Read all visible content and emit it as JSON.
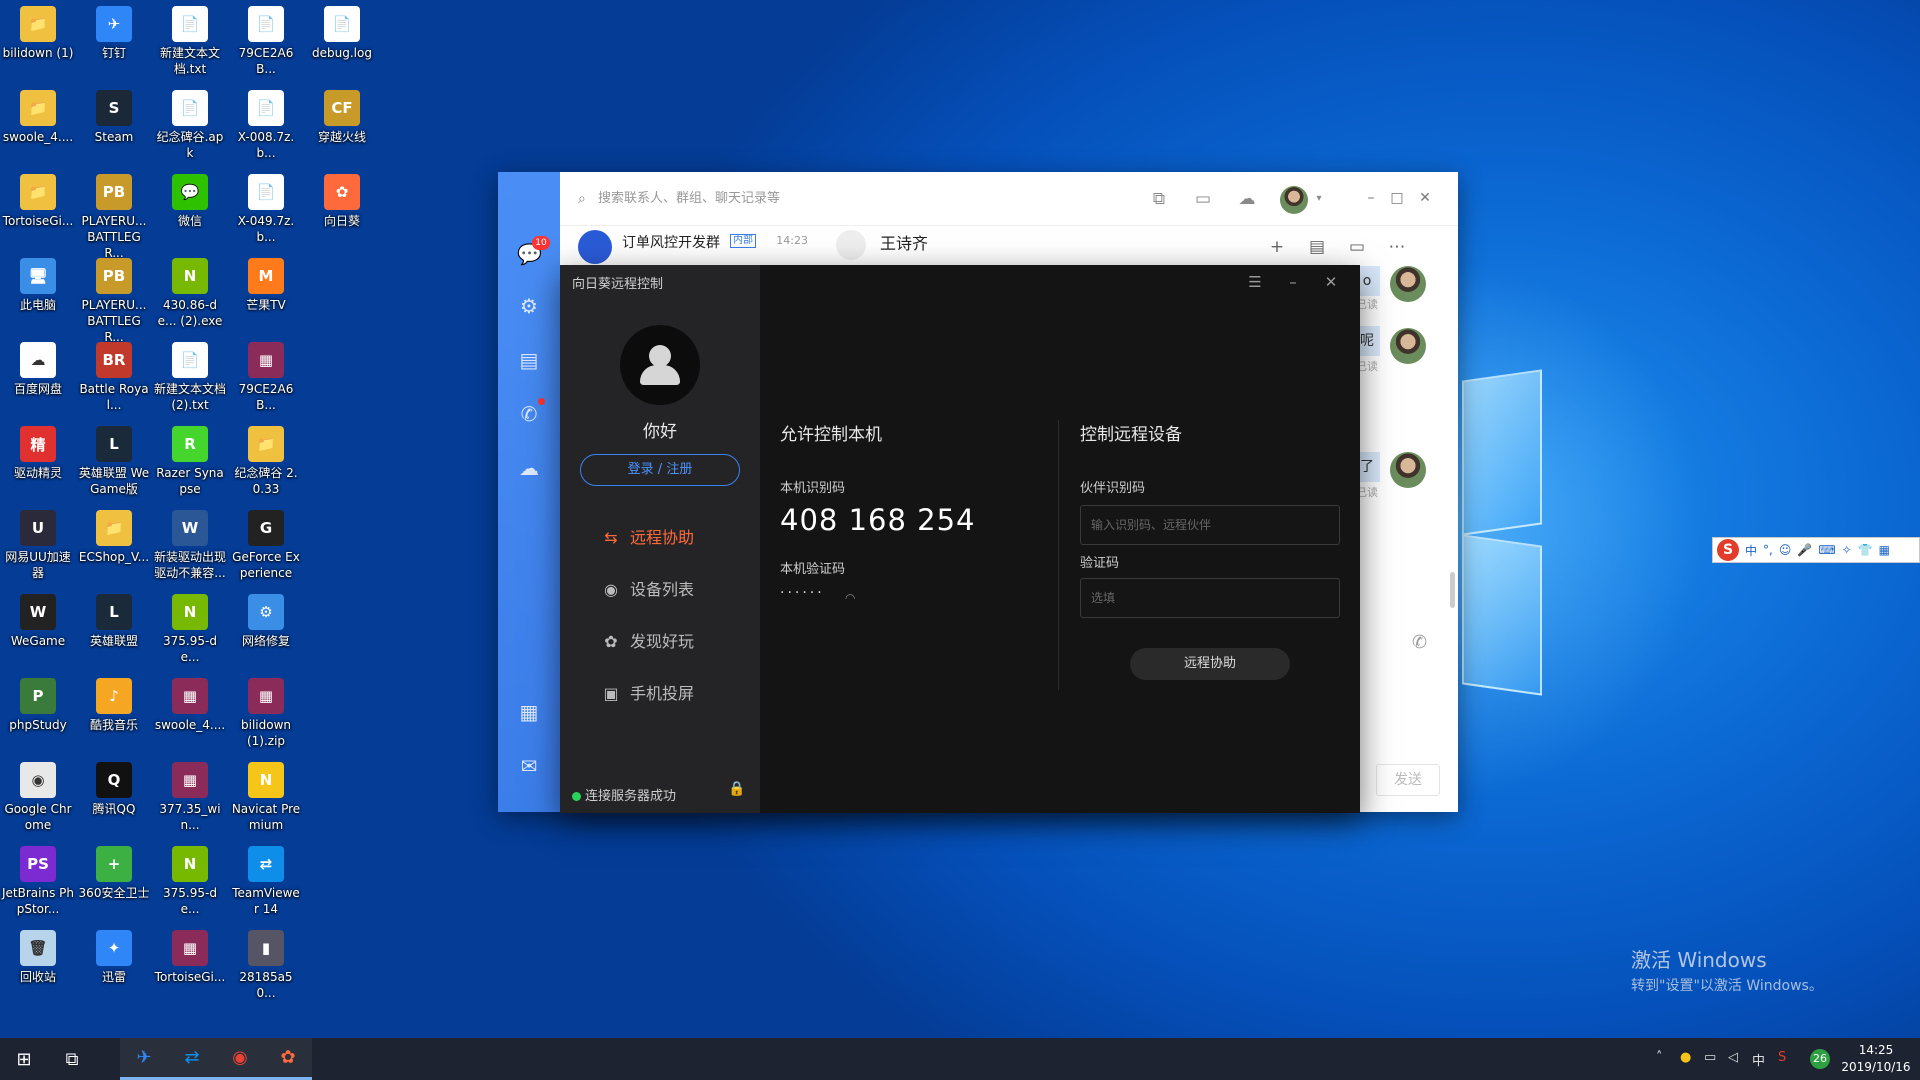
{
  "desktop": {
    "icons": [
      {
        "label": "bilidown (1)",
        "glyph": "📁",
        "color": "#f0c040"
      },
      {
        "label": "swoole_4....",
        "glyph": "📁",
        "color": "#f0c040"
      },
      {
        "label": "TortoiseGi...",
        "glyph": "📁",
        "color": "#f0c040"
      },
      {
        "label": "此电脑",
        "glyph": "🖥",
        "color": "#3a8ee6"
      },
      {
        "label": "百度网盘",
        "glyph": "☁",
        "color": "#ffffff"
      },
      {
        "label": "驱动精灵",
        "glyph": "精",
        "color": "#e03030"
      },
      {
        "label": "网易UU加速器",
        "glyph": "U",
        "color": "#2a2a3a"
      },
      {
        "label": "WeGame",
        "glyph": "W",
        "color": "#222222"
      },
      {
        "label": "phpStudy",
        "glyph": "P",
        "color": "#3a7a3a"
      },
      {
        "label": "Google Chrome",
        "glyph": "◉",
        "color": "#e8e8e8"
      },
      {
        "label": "JetBrains PhpStor...",
        "glyph": "PS",
        "color": "#7b2bd1"
      },
      {
        "label": "回收站",
        "glyph": "🗑",
        "color": "#b8d4ea"
      },
      {
        "label": "钉钉",
        "glyph": "✈",
        "color": "#2f86f6"
      },
      {
        "label": "Steam",
        "glyph": "S",
        "color": "#1b2838"
      },
      {
        "label": "PLAYERU... BATTLEGR...",
        "glyph": "PB",
        "color": "#c79a2a"
      },
      {
        "label": "PLAYERU... BATTLEGR...",
        "glyph": "PB",
        "color": "#c79a2a"
      },
      {
        "label": "Battle Royal...",
        "glyph": "BR",
        "color": "#c0392b"
      },
      {
        "label": "英雄联盟 WeGame版",
        "glyph": "L",
        "color": "#1a2a3a"
      },
      {
        "label": "ECShop_V...",
        "glyph": "📁",
        "color": "#f0c040"
      },
      {
        "label": "英雄联盟",
        "glyph": "L",
        "color": "#1a2a3a"
      },
      {
        "label": "酷我音乐",
        "glyph": "♪",
        "color": "#f5a623"
      },
      {
        "label": "腾讯QQ",
        "glyph": "Q",
        "color": "#111111"
      },
      {
        "label": "360安全卫士",
        "glyph": "+",
        "color": "#3cb043"
      },
      {
        "label": "迅雷",
        "glyph": "✦",
        "color": "#2f86f6"
      },
      {
        "label": "新建文本文档.txt",
        "glyph": "📄",
        "color": "#ffffff"
      },
      {
        "label": "纪念碑谷.apk",
        "glyph": "📄",
        "color": "#ffffff"
      },
      {
        "label": "微信",
        "glyph": "💬",
        "color": "#2dc100"
      },
      {
        "label": "430.86-de... (2).exe",
        "glyph": "N",
        "color": "#76b900"
      },
      {
        "label": "新建文本文档 (2).txt",
        "glyph": "📄",
        "color": "#ffffff"
      },
      {
        "label": "Razer Synapse",
        "glyph": "R",
        "color": "#44d62c"
      },
      {
        "label": "新装驱动出现驱动不兼容...",
        "glyph": "W",
        "color": "#2b5797"
      },
      {
        "label": "375.95-de...",
        "glyph": "N",
        "color": "#76b900"
      },
      {
        "label": "swoole_4....",
        "glyph": "▦",
        "color": "#8b2b5a"
      },
      {
        "label": "377.35_win...",
        "glyph": "▦",
        "color": "#8b2b5a"
      },
      {
        "label": "375.95-de...",
        "glyph": "N",
        "color": "#76b900"
      },
      {
        "label": "TortoiseGi...",
        "glyph": "▦",
        "color": "#8b2b5a"
      },
      {
        "label": "79CE2A6B...",
        "glyph": "📄",
        "color": "#ffffff"
      },
      {
        "label": "X-008.7z.b...",
        "glyph": "📄",
        "color": "#ffffff"
      },
      {
        "label": "X-049.7z.b...",
        "glyph": "📄",
        "color": "#ffffff"
      },
      {
        "label": "芒果TV",
        "glyph": "M",
        "color": "#ff7a1a"
      },
      {
        "label": "79CE2A6B...",
        "glyph": "▦",
        "color": "#8b2b5a"
      },
      {
        "label": "纪念碑谷 2.0.33",
        "glyph": "📁",
        "color": "#f0c040"
      },
      {
        "label": "GeForce Experience",
        "glyph": "G",
        "color": "#222222"
      },
      {
        "label": "网络修复",
        "glyph": "⚙",
        "color": "#3a8ee6"
      },
      {
        "label": "bilidown (1).zip",
        "glyph": "▦",
        "color": "#8b2b5a"
      },
      {
        "label": "Navicat Premium",
        "glyph": "N",
        "color": "#f5c518"
      },
      {
        "label": "TeamViewer 14",
        "glyph": "⇄",
        "color": "#0e8ee9"
      },
      {
        "label": "28185a50...",
        "glyph": "▮",
        "color": "#556"
      },
      {
        "label": "debug.log",
        "glyph": "📄",
        "color": "#ffffff"
      },
      {
        "label": "穿越火线",
        "glyph": "CF",
        "color": "#c79a2a"
      },
      {
        "label": "向日葵",
        "glyph": "✿",
        "color": "#ff6a3d"
      }
    ]
  },
  "chat_app": {
    "search_placeholder": "搜索联系人、群组、聊天记录等",
    "sidebar_badge": "10",
    "conversation": {
      "name": "订单风控开发群",
      "tag": "内部",
      "time": "14:23"
    },
    "chat_header_name": "王诗齐",
    "bubbles": [
      "o",
      "呢",
      "了"
    ],
    "read_label": "已读",
    "send_label": "发送"
  },
  "remote_app": {
    "title": "向日葵远程控制",
    "greeting": "你好",
    "login_label": "登录 / 注册",
    "nav": [
      {
        "label": "远程协助",
        "icon": "remote-assist-icon",
        "active": true
      },
      {
        "label": "设备列表",
        "icon": "device-list-icon",
        "active": false
      },
      {
        "label": "发现好玩",
        "icon": "discover-icon",
        "active": false
      },
      {
        "label": "手机投屏",
        "icon": "screen-cast-icon",
        "active": false
      }
    ],
    "status": "连接服务器成功",
    "allow": {
      "title": "允许控制本机",
      "id_label": "本机识别码",
      "id_value": "408 168 254",
      "code_label": "本机验证码",
      "code_value": "······"
    },
    "control": {
      "title": "控制远程设备",
      "partner_label": "伙伴识别码",
      "partner_placeholder": "输入识别码、远程伙伴",
      "verify_label": "验证码",
      "verify_placeholder": "选填",
      "button": "远程协助"
    }
  },
  "ime": {
    "lang": "中",
    "punct": "°,"
  },
  "watermark": {
    "line1": "激活 Windows",
    "line2": "转到\"设置\"以激活 Windows。"
  },
  "taskbar": {
    "tray_lang": "中",
    "tray_temp": "26",
    "time": "14:25",
    "date": "2019/10/16"
  }
}
